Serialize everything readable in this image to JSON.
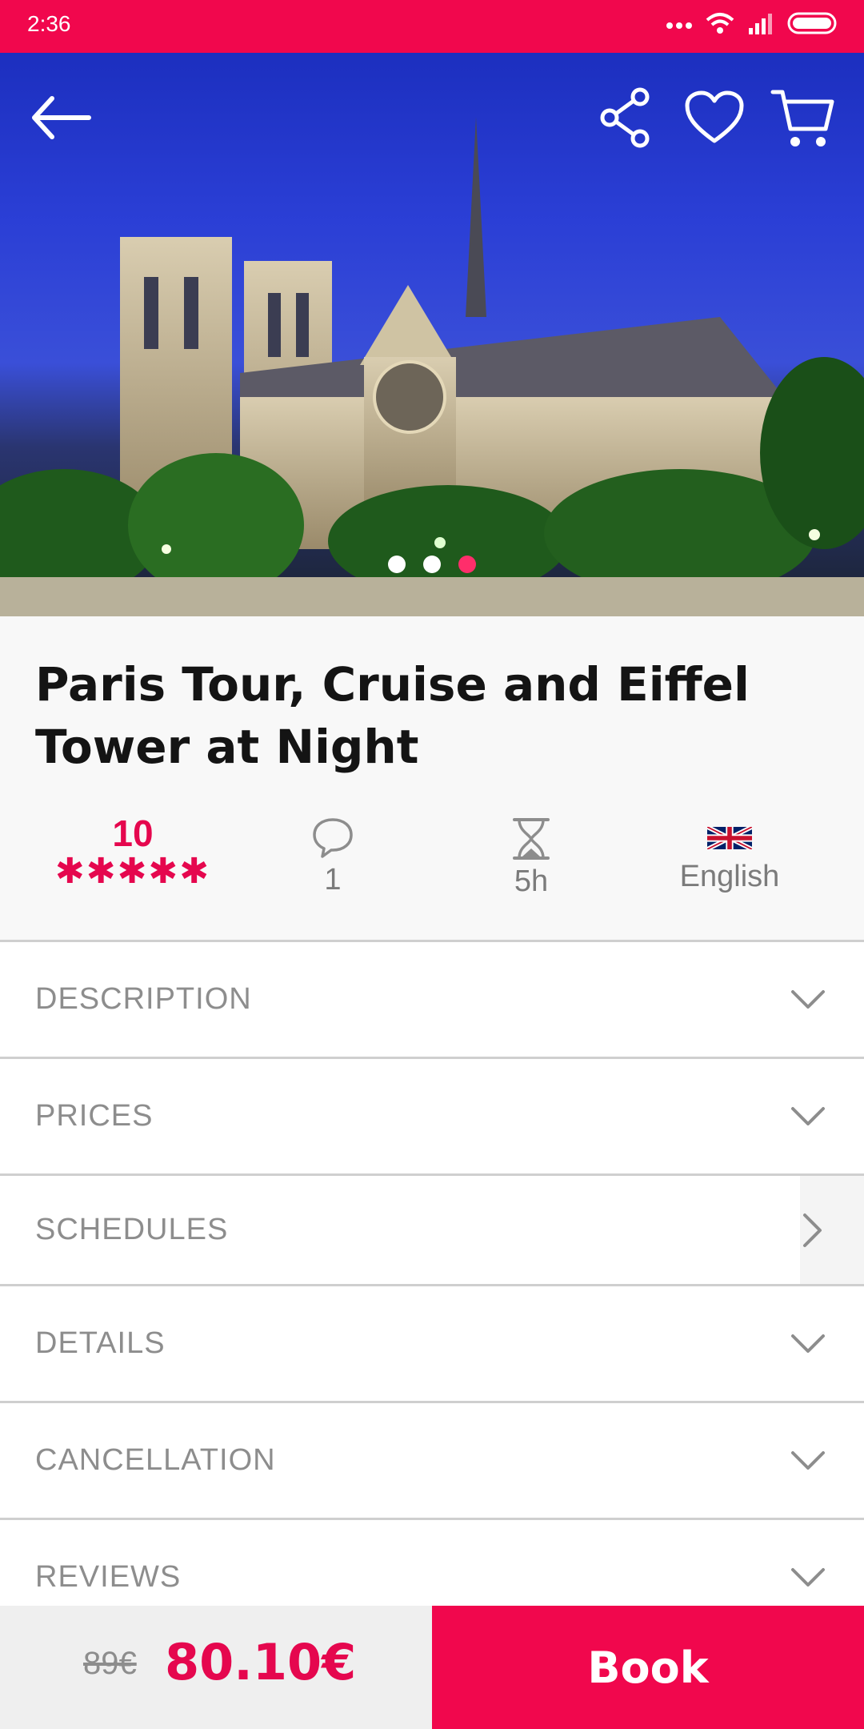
{
  "status_bar": {
    "time": "2:36"
  },
  "hero": {
    "pagination": {
      "total": 3,
      "active": 3
    }
  },
  "tour": {
    "title": "Paris Tour, Cruise and Eiffel Tower at Night",
    "rating": "10",
    "stars": "✱✱✱✱✱",
    "reviews_count": "1",
    "duration": "5h",
    "language": "English"
  },
  "sections": [
    {
      "label": "DESCRIPTION",
      "icon": "chevron-down-icon"
    },
    {
      "label": "PRICES",
      "icon": "chevron-down-icon"
    },
    {
      "label": "SCHEDULES",
      "icon": "chevron-right-icon"
    },
    {
      "label": "DETAILS",
      "icon": "chevron-down-icon"
    },
    {
      "label": "CANCELLATION",
      "icon": "chevron-down-icon"
    },
    {
      "label": "REVIEWS",
      "icon": "chevron-down-icon"
    }
  ],
  "booking": {
    "old_price": "89€",
    "price": "80.10€",
    "book_label": "Book"
  },
  "colors": {
    "brand": "#f1074d",
    "accent": "#e5074e"
  }
}
